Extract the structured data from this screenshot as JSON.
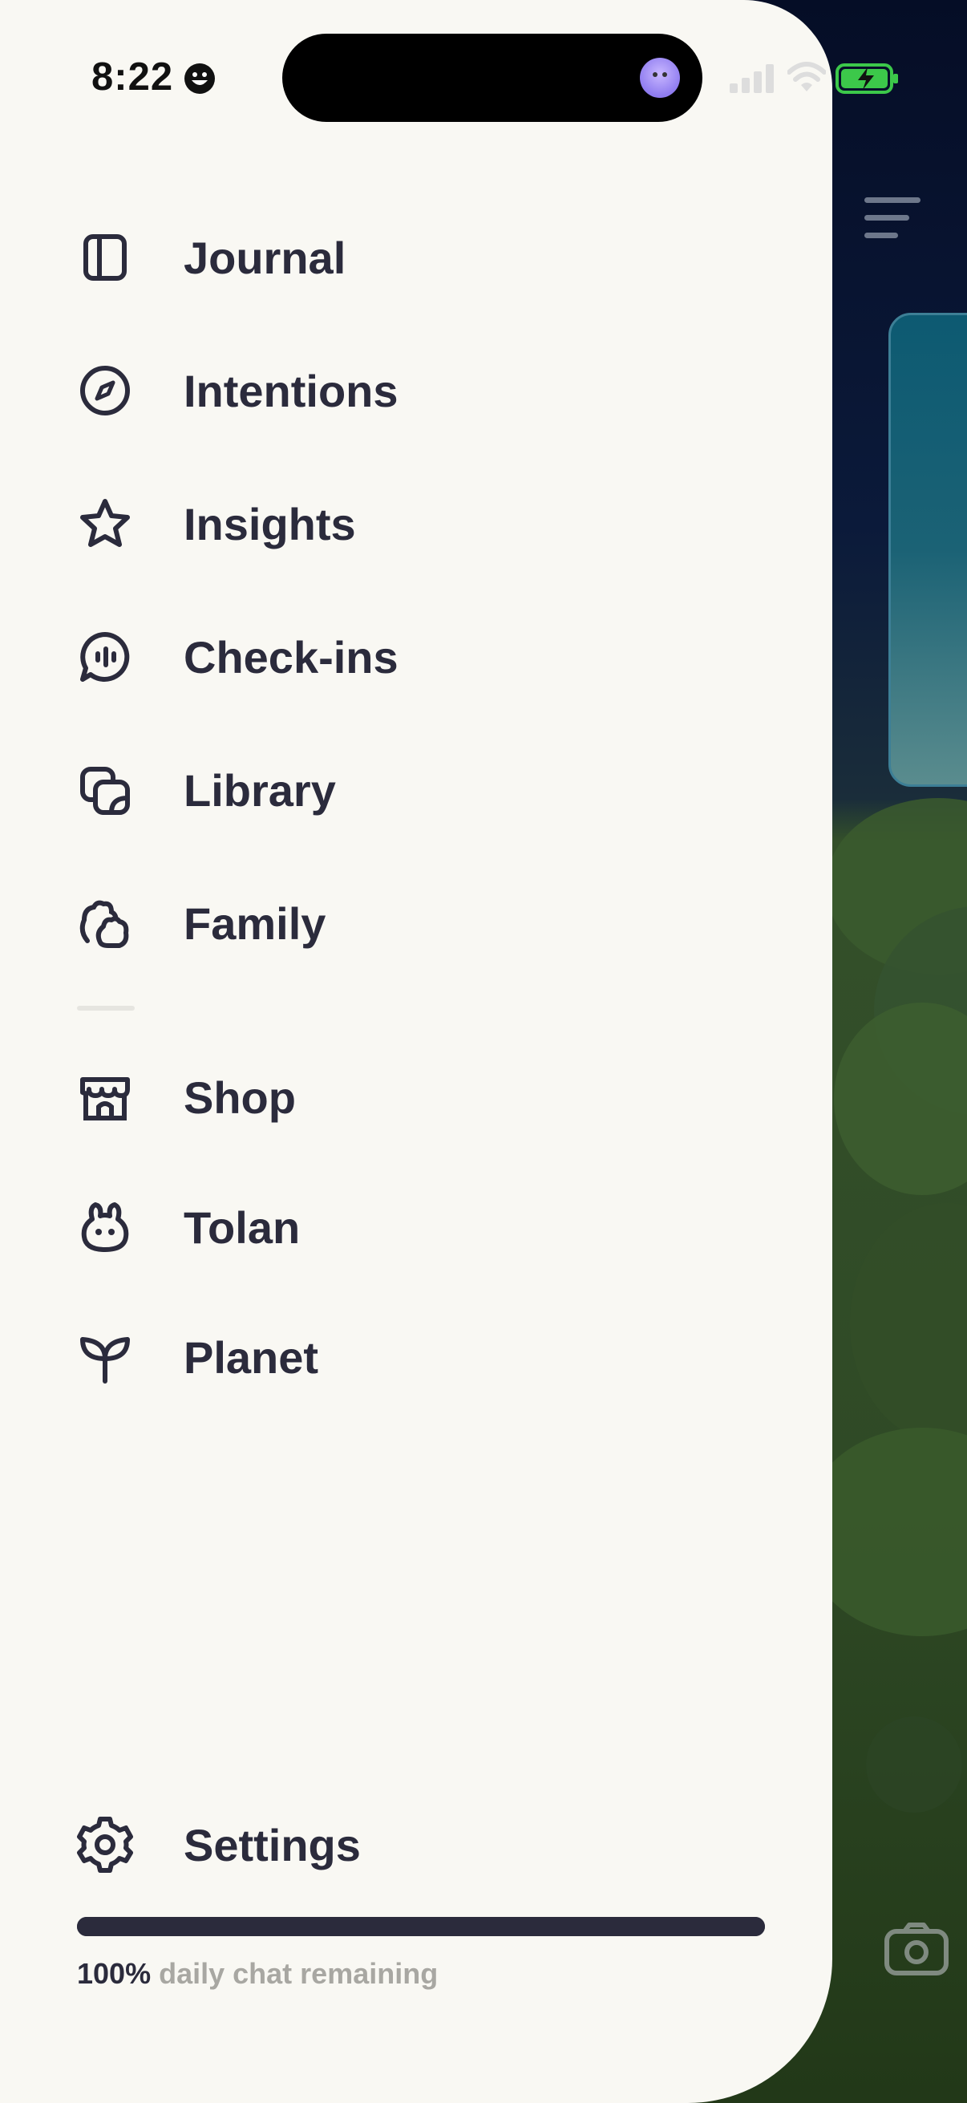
{
  "status_bar": {
    "time": "8:22",
    "battery_color": "#3cc84a"
  },
  "drawer": {
    "items": [
      {
        "label": "Journal",
        "icon": "journal-icon"
      },
      {
        "label": "Intentions",
        "icon": "compass-icon"
      },
      {
        "label": "Insights",
        "icon": "star-icon"
      },
      {
        "label": "Check-ins",
        "icon": "chat-bubble-icon"
      },
      {
        "label": "Library",
        "icon": "library-icon"
      },
      {
        "label": "Family",
        "icon": "family-icon"
      },
      {
        "label": "Shop",
        "icon": "shop-icon"
      },
      {
        "label": "Tolan",
        "icon": "tolan-icon"
      },
      {
        "label": "Planet",
        "icon": "sprout-icon"
      }
    ],
    "settings": {
      "label": "Settings",
      "icon": "gear-icon"
    }
  },
  "chat_quota": {
    "percent_text": "100%",
    "caption": "daily chat remaining",
    "fraction": 1.0
  },
  "colors": {
    "drawer_bg": "#f9f8f3",
    "text": "#2b2b3c",
    "muted": "#a8a7a2"
  }
}
